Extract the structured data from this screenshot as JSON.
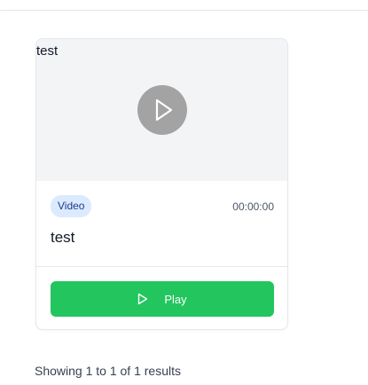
{
  "video_card": {
    "media_title": "test",
    "media_icon": "play-icon",
    "badge_label": "Video",
    "duration": "00:00:00",
    "title": "test",
    "play_button": {
      "label": "Play",
      "icon": "play-icon"
    }
  },
  "pagination": {
    "results_text": "Showing 1 to 1 of 1 results"
  },
  "colors": {
    "play_button_bg": "#22c55e",
    "badge_bg": "#dbeafe",
    "badge_text": "#1e3a8a",
    "media_bg": "#f3f4f6",
    "play_overlay_bg": "#a3a3a3"
  }
}
